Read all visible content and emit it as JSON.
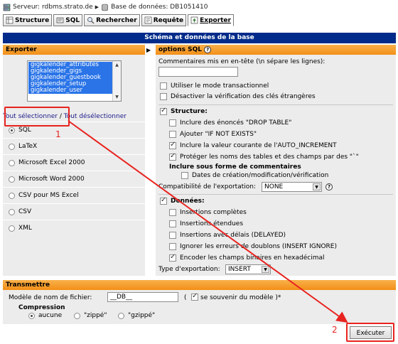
{
  "breadcrumb": {
    "server_label": "Serveur: rdbms.strato.de",
    "db_label": "Base de données: DB1051410"
  },
  "tabs": [
    {
      "label": "Structure",
      "icon": "structure-icon"
    },
    {
      "label": "SQL",
      "icon": "sql-icon"
    },
    {
      "label": "Rechercher",
      "icon": "search-icon"
    },
    {
      "label": "Requête",
      "icon": "query-icon"
    },
    {
      "label": "Exporter",
      "icon": "export-icon",
      "active": true
    }
  ],
  "panel_title": "Schéma et données de la base",
  "export": {
    "title": "Exporter",
    "tables": [
      "gigkalender_attributes",
      "gigkalender_gigs",
      "gigkalender_guestbook",
      "gigkalender_setup",
      "gigkalender_user"
    ],
    "select_all": "Tout sélectionner",
    "separator": " / ",
    "deselect_all": "Tout désélectionner",
    "formats": [
      {
        "label": "SQL",
        "selected": true
      },
      {
        "label": "LaTeX",
        "selected": false
      },
      {
        "label": "Microsoft Excel 2000",
        "selected": false
      },
      {
        "label": "Microsoft Word 2000",
        "selected": false
      },
      {
        "label": "CSV pour MS Excel",
        "selected": false
      },
      {
        "label": "CSV",
        "selected": false
      },
      {
        "label": "XML",
        "selected": false
      }
    ]
  },
  "sql_options": {
    "title": "options SQL",
    "comment_label": "Commentaires mis en en-tête (\\n sépare les lignes):",
    "comment_value": "",
    "transactional": "Utiliser le mode transactionnel",
    "disable_fk": "Désactiver la vérification des clés étrangères",
    "structure": {
      "title": "Structure:",
      "drop_table": "Inclure des énoncés \"DROP TABLE\"",
      "if_not_exists": "Ajouter \"IF NOT EXISTS\"",
      "auto_increment": "Inclure la valeur courante de l'AUTO_INCREMENT",
      "backquotes": "Protéger les noms des tables et des champs par des \"`\"",
      "comments_title": "Inclure sous forme de commentaires",
      "dates": "Dates de création/modification/vérification",
      "compat_label": "Compatibilité de l'exportation:",
      "compat_value": "NONE"
    },
    "data": {
      "title": "Données:",
      "complete_inserts": "Insertions complètes",
      "extended_inserts": "Insertions étendues",
      "delayed_inserts": "Insertions avec délais (DELAYED)",
      "ignore_dup": "Ignorer les erreurs de doublons (INSERT IGNORE)",
      "hex_binary": "Encoder les champs binaires en hexadécimal",
      "export_type_label": "Type d'exportation:",
      "export_type_value": "INSERT"
    }
  },
  "transmit": {
    "title": "Transmettre",
    "filename_label": "Modèle de nom de fichier:",
    "filename_value": "__DB__",
    "remember_open": "(",
    "remember_label": "se souvenir du modèle )*",
    "compression_label": "Compression",
    "compression_options": [
      "aucune",
      "\"zippé\"",
      "\"gzippé\""
    ]
  },
  "execute_label": "Exécuter",
  "annotations": {
    "one": "1",
    "two": "2"
  },
  "colors": {
    "header_blue": "#002b8a",
    "section_orange": "#f28f18",
    "highlight_red": "#e8231f",
    "panel_grey": "#ececec",
    "selection_blue": "#2a74e8"
  }
}
